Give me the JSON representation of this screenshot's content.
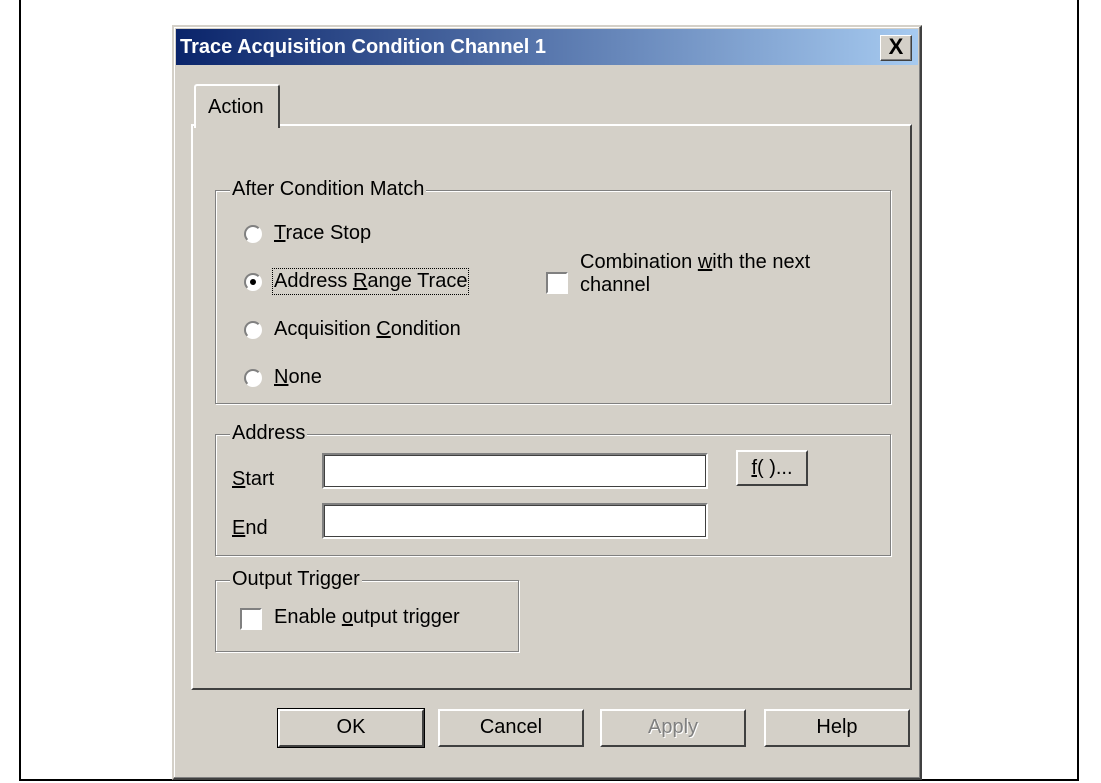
{
  "window": {
    "title": "Trace Acquisition Condition Channel 1",
    "close_glyph": "X"
  },
  "tabs": [
    {
      "label": "Action",
      "selected": true
    }
  ],
  "after_condition": {
    "label": "After Condition Match",
    "options": [
      {
        "pre": "",
        "u": "T",
        "post": "race Stop",
        "selected": false
      },
      {
        "pre": "Address ",
        "u": "R",
        "post": "ange Trace",
        "selected": true
      },
      {
        "pre": "Acquisition ",
        "u": "C",
        "post": "ondition",
        "selected": false
      },
      {
        "pre": "",
        "u": "N",
        "post": "one",
        "selected": false
      }
    ],
    "combination": {
      "line1_pre": "Combination ",
      "line1_u": "w",
      "line1_post": "ith the next",
      "line2": "channel",
      "checked": false
    }
  },
  "address": {
    "label": "Address",
    "start_u": "S",
    "start_post": "tart",
    "end_u": "E",
    "end_post": "nd",
    "start_value": "",
    "end_value": "",
    "func_button_u": "f",
    "func_button_post": "( )..."
  },
  "output_trigger": {
    "label": "Output Trigger",
    "checkbox_pre": "Enable ",
    "checkbox_u": "o",
    "checkbox_post": "utput trigger",
    "checked": false
  },
  "buttons": {
    "ok": "OK",
    "cancel": "Cancel",
    "apply": "Apply",
    "help": "Help"
  },
  "colors": {
    "face": "#d4d0c8",
    "title_start": "#0a246a",
    "title_end": "#a6caf0"
  }
}
